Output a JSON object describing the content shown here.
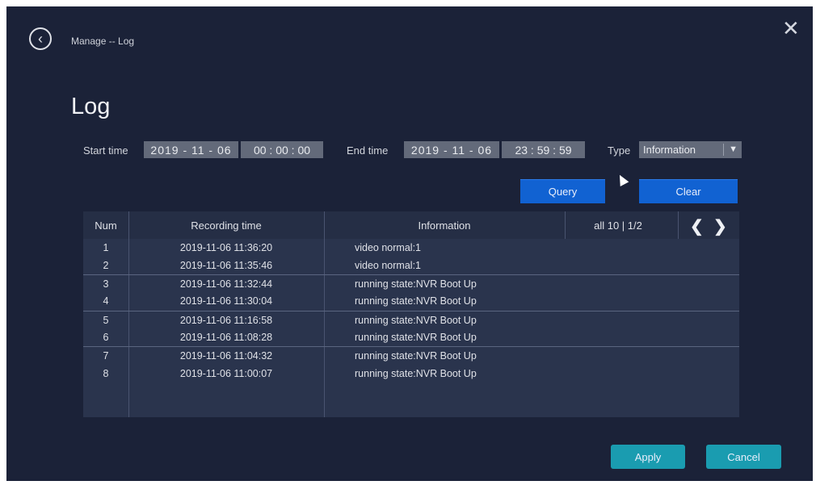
{
  "header": {
    "breadcrumb": "Manage -- Log",
    "back_icon": "chevron-left-circle",
    "close_icon": "close"
  },
  "page_title": "Log",
  "filters": {
    "start_label": "Start time",
    "start_date": "2019 - 11 - 06",
    "start_time": "00 : 00 : 00",
    "end_label": "End time",
    "end_date": "2019 - 11 - 06",
    "end_time": "23 : 59 : 59",
    "type_label": "Type",
    "type_value": "Information"
  },
  "actions": {
    "query": "Query",
    "clear": "Clear",
    "apply": "Apply",
    "cancel": "Cancel"
  },
  "table": {
    "headers": {
      "num": "Num",
      "time": "Recording time",
      "info": "Information"
    },
    "pagination": "all 10 | 1/2",
    "rows": [
      {
        "num": "1",
        "time": "2019-11-06 11:36:20",
        "info": "video normal:1"
      },
      {
        "num": "2",
        "time": "2019-11-06 11:35:46",
        "info": "video normal:1"
      },
      {
        "num": "3",
        "time": "2019-11-06 11:32:44",
        "info": "running state:NVR Boot Up"
      },
      {
        "num": "4",
        "time": "2019-11-06 11:30:04",
        "info": "running state:NVR Boot Up"
      },
      {
        "num": "5",
        "time": "2019-11-06 11:16:58",
        "info": "running state:NVR Boot Up"
      },
      {
        "num": "6",
        "time": "2019-11-06 11:08:28",
        "info": "running state:NVR Boot Up"
      },
      {
        "num": "7",
        "time": "2019-11-06 11:04:32",
        "info": "running state:NVR Boot Up"
      },
      {
        "num": "8",
        "time": "2019-11-06 11:00:07",
        "info": "running state:NVR Boot Up"
      }
    ]
  },
  "colors": {
    "background": "#1b2238",
    "primary_button": "#1162d2",
    "secondary_button": "#1a9cb0",
    "field": "#636a7a"
  }
}
